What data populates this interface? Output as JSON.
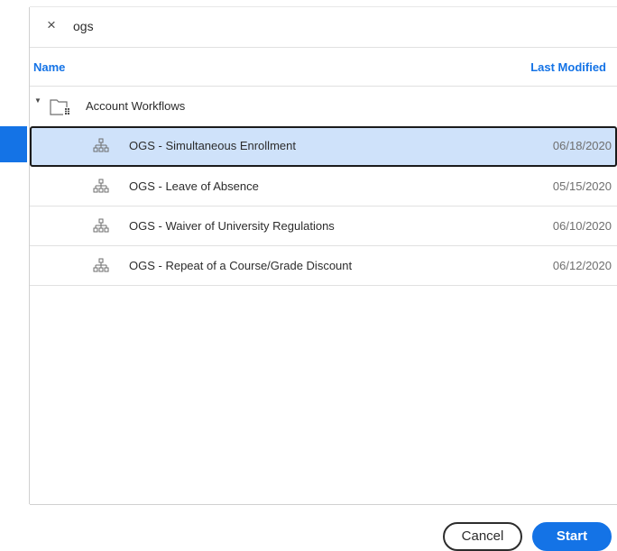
{
  "search": {
    "clear_glyph": "×",
    "value": "ogs"
  },
  "columns": {
    "name": "Name",
    "last_modified": "Last Modified"
  },
  "folder": {
    "label": "Account Workflows",
    "icon": "folder-icon",
    "expanded": true
  },
  "items": [
    {
      "name": "OGS - Simultaneous Enrollment",
      "date": "06/18/2020",
      "icon": "workflow-icon",
      "selected": true
    },
    {
      "name": "OGS - Leave of Absence",
      "date": "05/15/2020",
      "icon": "workflow-icon",
      "selected": false
    },
    {
      "name": "OGS - Waiver of University Regulations",
      "date": "06/10/2020",
      "icon": "workflow-icon",
      "selected": false
    },
    {
      "name": "OGS - Repeat of a Course/Grade Discount",
      "date": "06/12/2020",
      "icon": "workflow-icon",
      "selected": false
    }
  ],
  "buttons": {
    "cancel": "Cancel",
    "start": "Start"
  },
  "colors": {
    "accent": "#1473e6",
    "selected_row": "#cfe2fa"
  }
}
